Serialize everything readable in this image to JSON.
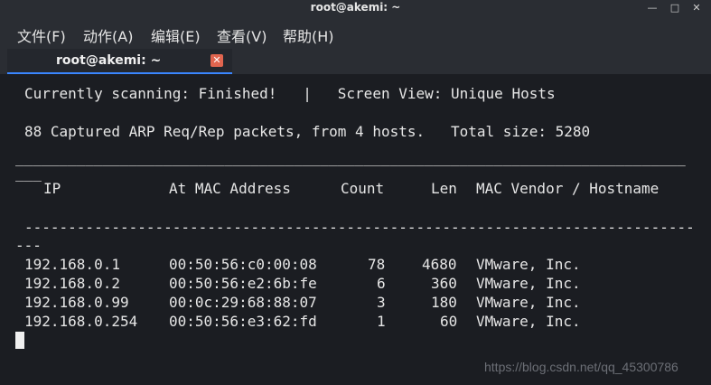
{
  "window": {
    "title": "root@akemi: ~",
    "min_glyph": "—",
    "max_glyph": "□",
    "close_glyph": "✕"
  },
  "menu": [
    "文件(F)",
    "动作(A)",
    "编辑(E)",
    "查看(V)",
    "帮助(H)"
  ],
  "tab": {
    "label": "root@akemi: ~",
    "close_glyph": "✕"
  },
  "terminal": {
    "status_line": "Currently scanning: Finished!   |   Screen View: Unique Hosts",
    "summary_line": "88 Captured ARP Req/Rep packets, from 4 hosts.   Total size: 5280",
    "separator_main": "_____________________________________________________________________________",
    "separator_wrap": "___",
    "headers": {
      "ip": "IP",
      "mac": "At MAC Address",
      "count": "Count",
      "len": "Len",
      "vendor": "MAC Vendor / Hostname"
    },
    "dash_main": "-----------------------------------------------------------------------------",
    "dash_wrap": "---",
    "rows": [
      {
        "ip": "192.168.0.1",
        "mac": "00:50:56:c0:00:08",
        "count": "78",
        "len": "4680",
        "vendor": "VMware, Inc."
      },
      {
        "ip": "192.168.0.2",
        "mac": "00:50:56:e2:6b:fe",
        "count": "6",
        "len": "360",
        "vendor": "VMware, Inc."
      },
      {
        "ip": "192.168.0.99",
        "mac": "00:0c:29:68:88:07",
        "count": "3",
        "len": "180",
        "vendor": "VMware, Inc."
      },
      {
        "ip": "192.168.0.254",
        "mac": "00:50:56:e3:62:fd",
        "count": "1",
        "len": "60",
        "vendor": "VMware, Inc."
      }
    ]
  },
  "watermark": "https://blog.csdn.net/qq_45300786"
}
